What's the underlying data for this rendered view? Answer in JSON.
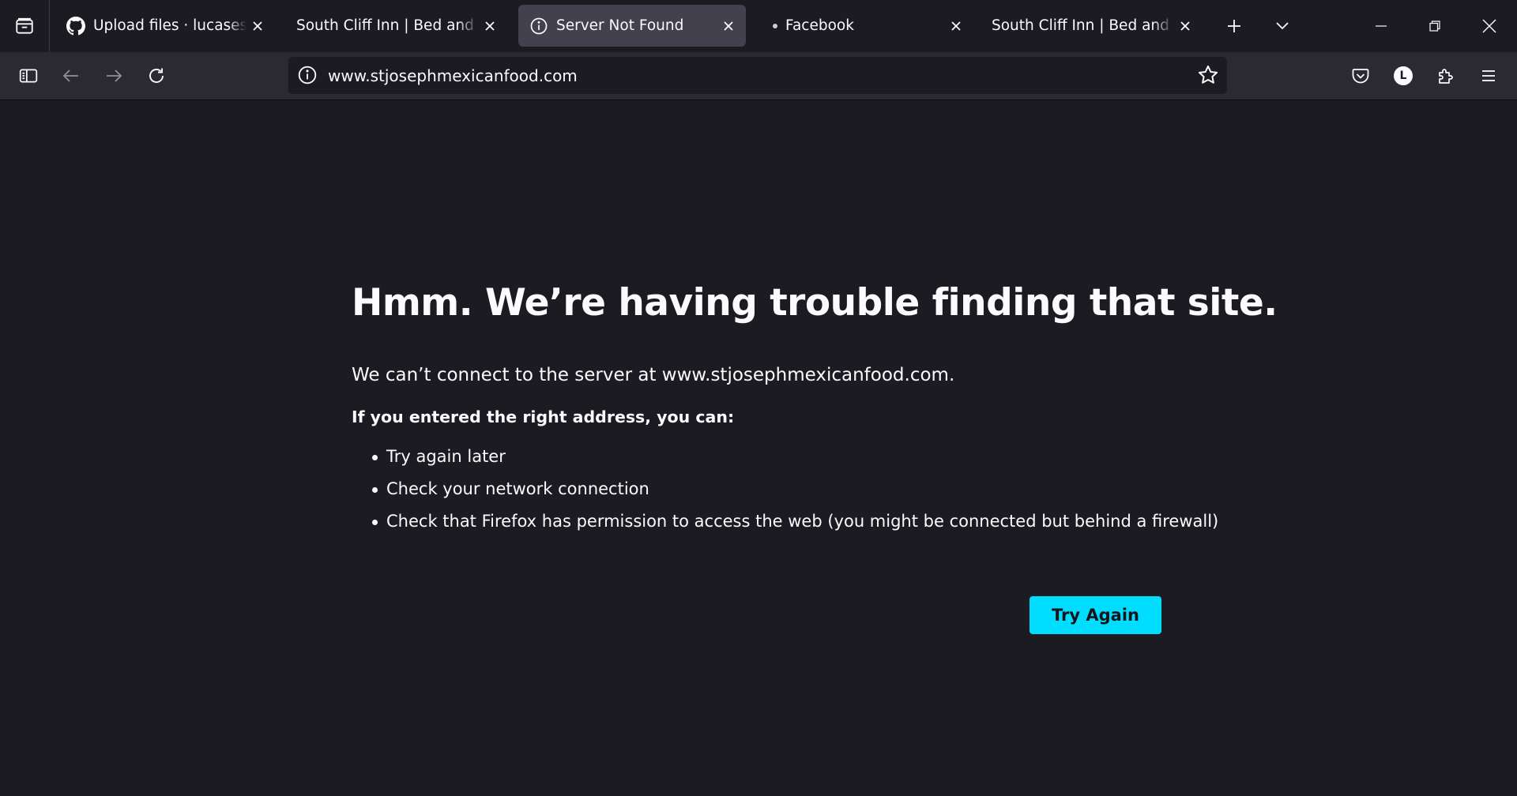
{
  "browser": {
    "tabs": [
      {
        "title": "Upload files · lucaseschultz",
        "icon": "github-icon",
        "active": false
      },
      {
        "title": "South Cliff Inn | Bed and Breakfast",
        "icon": "",
        "active": false
      },
      {
        "title": "Server Not Found",
        "icon": "info-icon",
        "active": true
      },
      {
        "title": "Facebook",
        "icon": "dot-icon",
        "active": false
      },
      {
        "title": "South Cliff Inn | Bed and Breakfast",
        "icon": "",
        "active": false
      }
    ],
    "url": "www.stjosephmexicanfood.com",
    "account_initial": "L",
    "accent_color": "#00ddff",
    "background_color": "#1c1b22"
  },
  "error_page": {
    "title": "Hmm. We’re having trouble finding that site.",
    "description": "We can’t connect to the server at www.stjosephmexicanfood.com.",
    "subheading": "If you entered the right address, you can:",
    "suggestions": [
      "Try again later",
      "Check your network connection",
      "Check that Firefox has permission to access the web (you might be connected but behind a firewall)"
    ],
    "button_label": "Try Again"
  }
}
